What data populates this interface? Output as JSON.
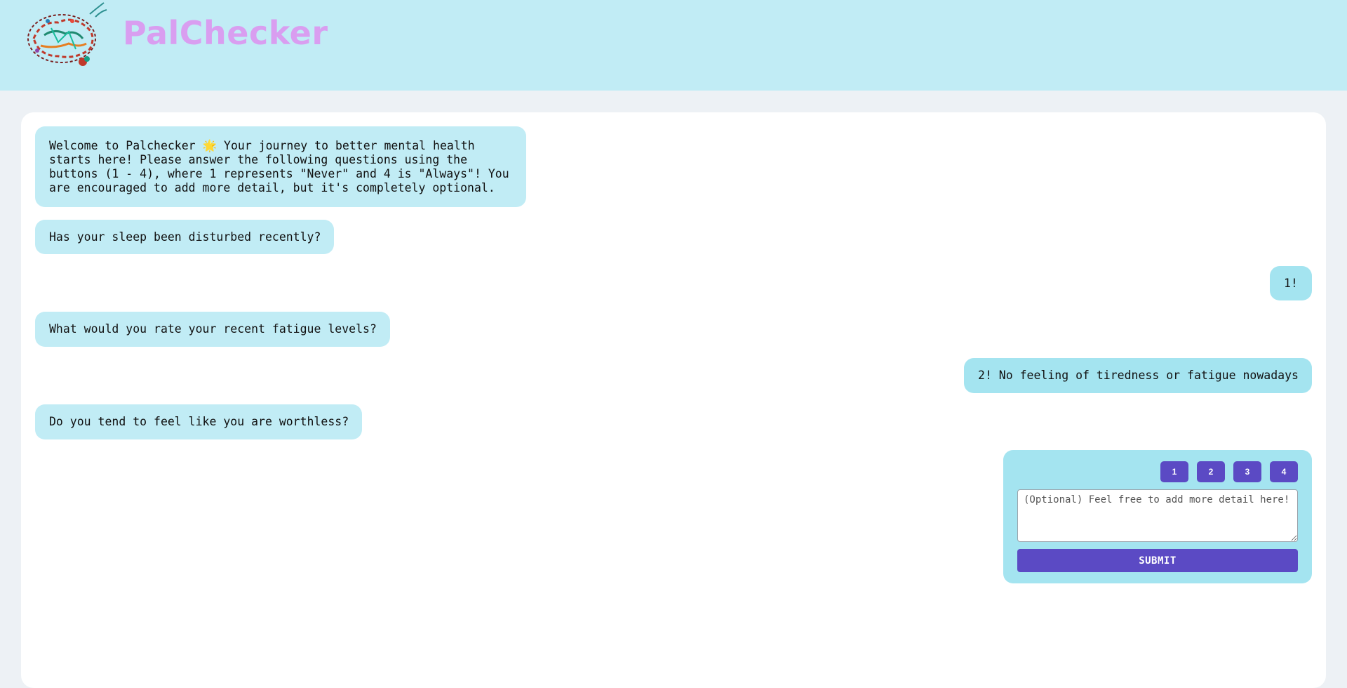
{
  "header": {
    "logo_icon": "brain-splatter-logo",
    "brand_name": "PalChecker",
    "brand_color": "#d99ef0",
    "background_color": "#c1ecf5"
  },
  "chat": {
    "messages": [
      {
        "role": "bot",
        "text": "Welcome to Palchecker 🌟 Your journey to better mental health starts here! Please answer the following questions using the buttons (1 - 4), where 1 represents \"Never\" and 4 is \"Always\"! You are encouraged to add more detail, but it's completely optional."
      },
      {
        "role": "bot",
        "text": "Has your sleep been disturbed recently?"
      },
      {
        "role": "user",
        "text": "1!"
      },
      {
        "role": "bot",
        "text": "What would you rate your recent fatigue levels?"
      },
      {
        "role": "user",
        "text": "2! No feeling of tiredness or fatigue nowadays"
      },
      {
        "role": "bot",
        "text": "Do you tend to feel like you are worthless?"
      }
    ]
  },
  "answer": {
    "options": [
      "1",
      "2",
      "3",
      "4"
    ],
    "detail_placeholder": "(Optional) Feel free to add more detail here!",
    "detail_value": "",
    "submit_label": "SUBMIT",
    "button_color": "#5b4ac4"
  }
}
